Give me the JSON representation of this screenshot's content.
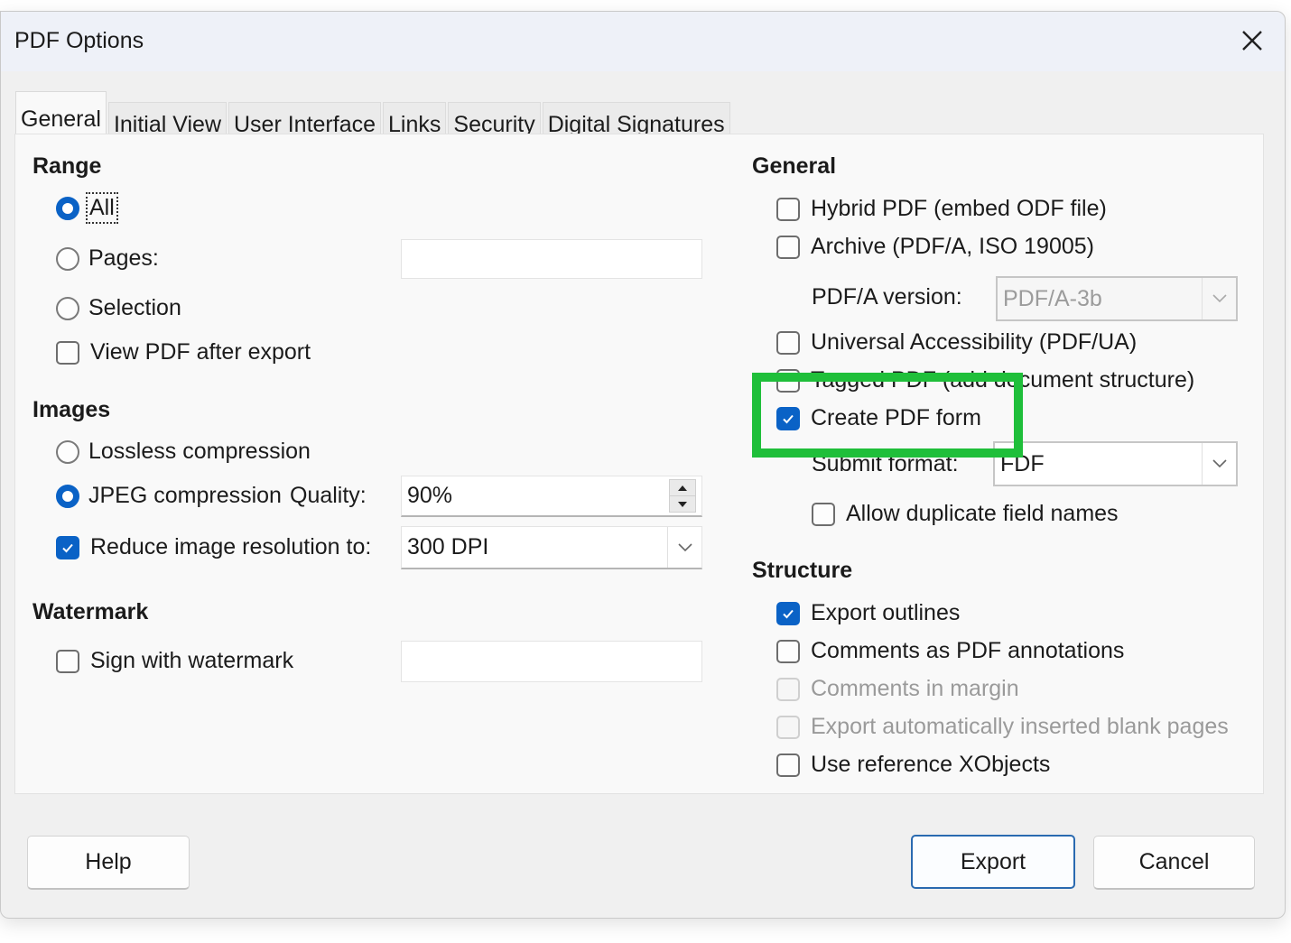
{
  "window": {
    "title": "PDF Options",
    "close_icon": "close-icon"
  },
  "tabs": [
    {
      "label": "General",
      "active": true
    },
    {
      "label": "Initial View",
      "active": false
    },
    {
      "label": "User Interface",
      "active": false
    },
    {
      "label": "Links",
      "active": false
    },
    {
      "label": "Security",
      "active": false
    },
    {
      "label": "Digital Signatures",
      "active": false
    }
  ],
  "range": {
    "title": "Range",
    "all_label": "All",
    "all_checked": true,
    "pages_label": "Pages:",
    "pages_checked": false,
    "pages_value": "",
    "selection_label": "Selection",
    "selection_checked": false,
    "view_pdf_label": "View PDF after export",
    "view_pdf_checked": false
  },
  "images": {
    "title": "Images",
    "lossless_label": "Lossless compression",
    "lossless_checked": false,
    "jpeg_label": "JPEG compression",
    "jpeg_checked": true,
    "quality_label": "Quality:",
    "quality_value": "90%",
    "reduce_label": "Reduce image resolution to:",
    "reduce_checked": true,
    "resolution_value": "300 DPI"
  },
  "watermark": {
    "title": "Watermark",
    "sign_label": "Sign with watermark",
    "sign_checked": false,
    "text_value": ""
  },
  "general": {
    "title": "General",
    "hybrid_label": "Hybrid PDF (embed ODF file)",
    "hybrid_checked": false,
    "archive_label": "Archive (PDF/A, ISO 19005)",
    "archive_checked": false,
    "pdfa_version_label": "PDF/A version:",
    "pdfa_version_value": "PDF/A-3b",
    "ua_label": "Universal Accessibility (PDF/UA)",
    "ua_checked": false,
    "tagged_label": "Tagged PDF (add document structure)",
    "tagged_checked": false,
    "create_form_label": "Create PDF form",
    "create_form_checked": true,
    "submit_format_label": "Submit format:",
    "submit_format_value": "FDF",
    "allow_duplicate_label": "Allow duplicate field names",
    "allow_duplicate_checked": false
  },
  "structure": {
    "title": "Structure",
    "export_outlines_label": "Export outlines",
    "export_outlines_checked": true,
    "comments_annotations_label": "Comments as PDF annotations",
    "comments_annotations_checked": false,
    "comments_margin_label": "Comments in margin",
    "comments_margin_checked": false,
    "export_blank_label": "Export automatically inserted blank pages",
    "export_blank_checked": false,
    "use_xobjects_label": "Use reference XObjects",
    "use_xobjects_checked": false
  },
  "buttons": {
    "help": "Help",
    "export": "Export",
    "cancel": "Cancel"
  },
  "highlight": {
    "color": "#1fbf3a",
    "target": "Create PDF form"
  }
}
